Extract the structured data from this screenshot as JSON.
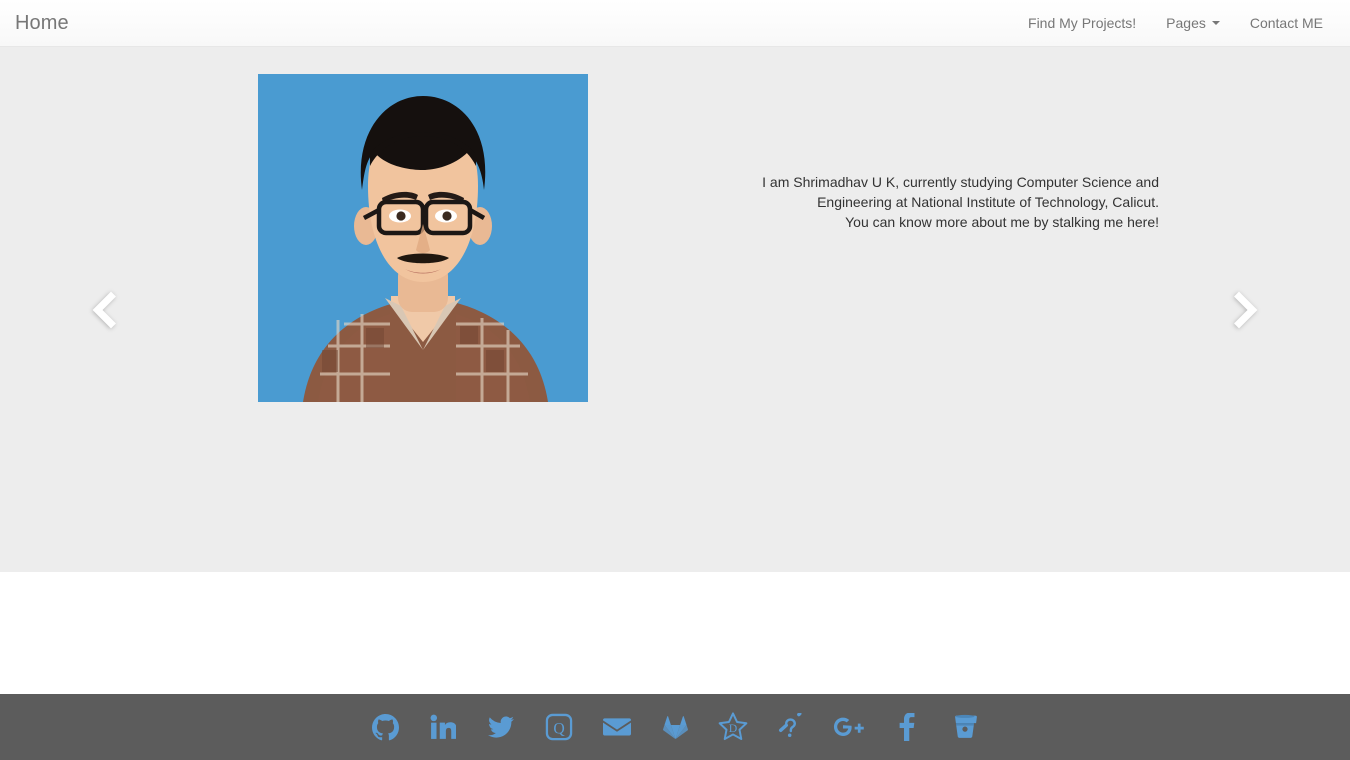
{
  "navbar": {
    "brand": "Home",
    "links": [
      {
        "label": "Find My Projects!",
        "name": "nav-link-find-my-projects",
        "caret": false
      },
      {
        "label": "Pages",
        "name": "nav-link-pages",
        "caret": true
      },
      {
        "label": "Contact ME",
        "name": "nav-link-contact-me",
        "caret": false
      }
    ]
  },
  "carousel": {
    "background_color": "#ededed",
    "prev_label": "Previous",
    "next_label": "Next",
    "slide": {
      "photo_alt": "Portrait photo of Shrimadhav U K on a blue background",
      "caption_lines": [
        "I am Shrimadhav U K, currently studying Computer Science and",
        "Engineering at National Institute of Technology, Calicut.",
        "You can know more about me by stalking me here!"
      ]
    }
  },
  "footer": {
    "background_color": "#5c5c5c",
    "icon_color": "#5a9bd3",
    "social": [
      {
        "name": "github-icon",
        "label": "GitHub"
      },
      {
        "name": "linkedin-icon",
        "label": "LinkedIn"
      },
      {
        "name": "twitter-icon",
        "label": "Twitter"
      },
      {
        "name": "quora-icon",
        "label": "Quora"
      },
      {
        "name": "envelope-icon",
        "label": "Email"
      },
      {
        "name": "gitlab-icon",
        "label": "GitLab"
      },
      {
        "name": "deviantart-icon",
        "label": "DeviantArt"
      },
      {
        "name": "assistive-listening-systems-icon",
        "label": "Assistive Listening Systems"
      },
      {
        "name": "google-plus-icon",
        "label": "Google Plus"
      },
      {
        "name": "facebook-icon",
        "label": "Facebook"
      },
      {
        "name": "bitbucket-icon",
        "label": "Bitbucket"
      }
    ]
  }
}
